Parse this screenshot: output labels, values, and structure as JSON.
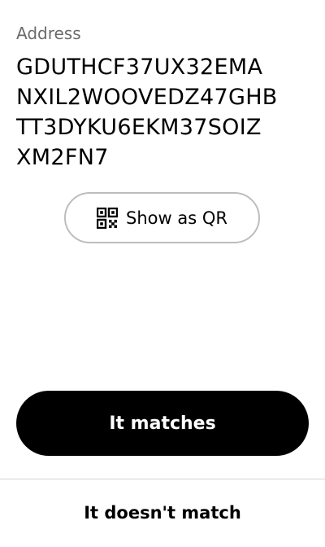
{
  "address": {
    "label": "Address",
    "lines": [
      "GDUTHCF37UX32EMA",
      "NXIL2WOOVEDZ47GHB",
      "TT3DYKU6EKM37SOIZ",
      "XM2FN7"
    ]
  },
  "qr_button": {
    "label": "Show as QR",
    "icon": "qr-code-icon"
  },
  "actions": {
    "match_label": "It matches",
    "no_match_label": "It doesn't match"
  },
  "colors": {
    "primary": "#000000",
    "on_primary": "#ffffff",
    "muted_text": "#6b6b6b",
    "outline": "#bdbdbd"
  }
}
